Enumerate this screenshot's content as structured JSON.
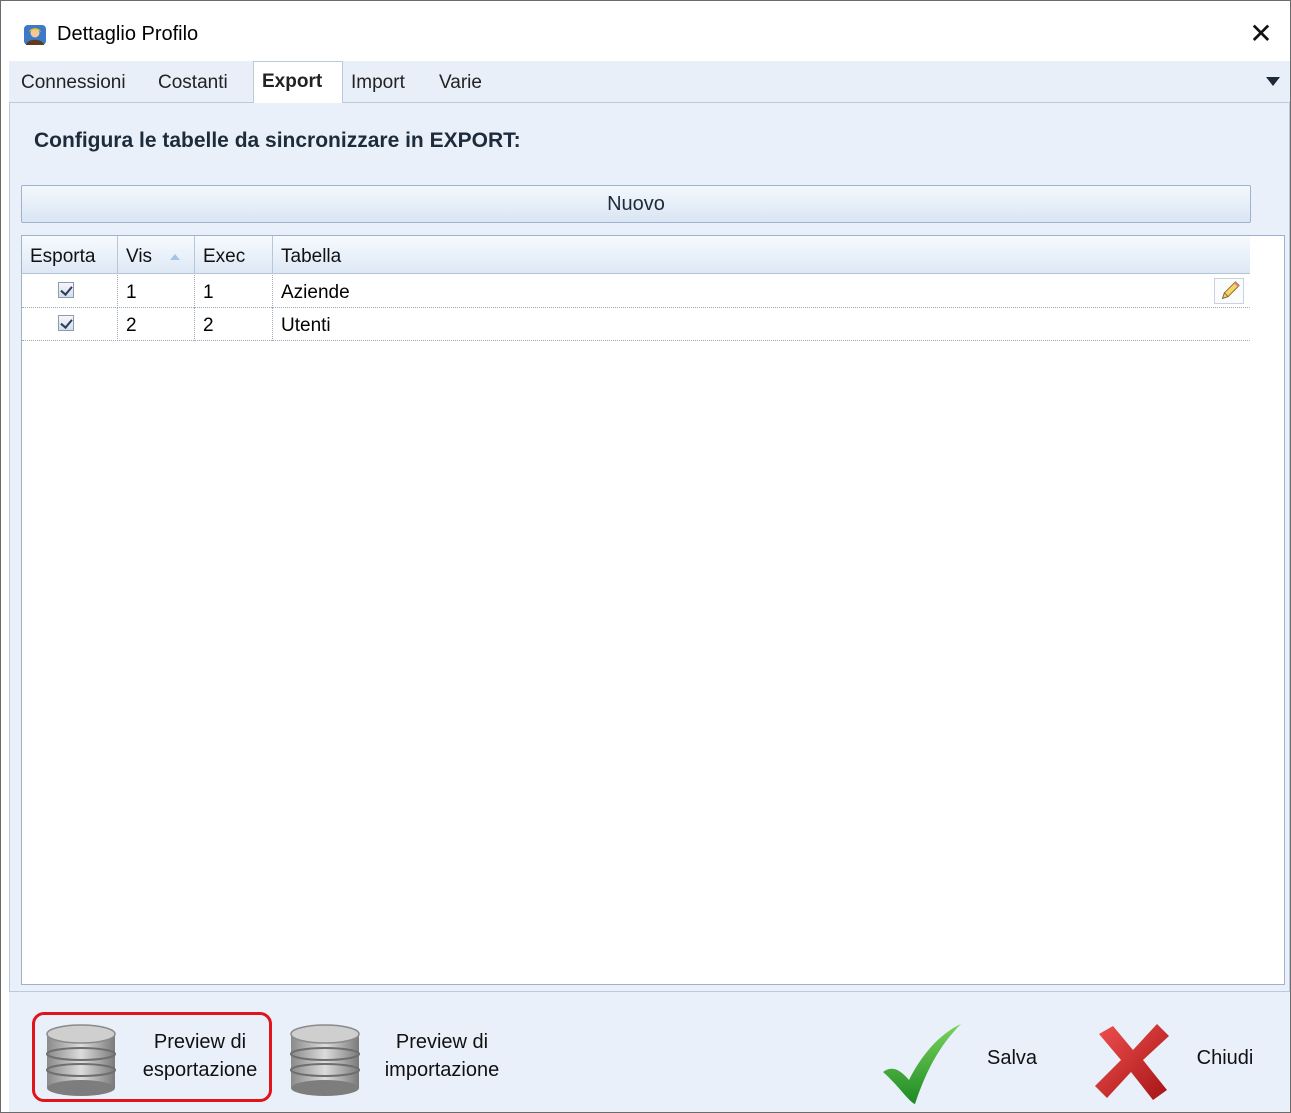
{
  "window": {
    "title": "Dettaglio Profilo",
    "close_glyph": "✕"
  },
  "tabs": [
    {
      "label": "Connessioni",
      "active": false
    },
    {
      "label": "Costanti",
      "active": false
    },
    {
      "label": "Export",
      "active": true
    },
    {
      "label": "Import",
      "active": false
    },
    {
      "label": "Varie",
      "active": false
    }
  ],
  "panel": {
    "heading": "Configura le tabelle da sincronizzare in EXPORT:",
    "new_button": "Nuovo"
  },
  "grid": {
    "columns": [
      "Esporta",
      "Vis",
      "Exec",
      "Tabella"
    ],
    "sorted_column": "Vis",
    "rows": [
      {
        "esporta": true,
        "vis": "1",
        "exec": "1",
        "tabella": "Aziende"
      },
      {
        "esporta": true,
        "vis": "2",
        "exec": "2",
        "tabella": "Utenti"
      }
    ]
  },
  "footer": {
    "preview_export_line1": "Preview di",
    "preview_export_line2": "esportazione",
    "preview_import_line1": "Preview di",
    "preview_import_line2": "importazione",
    "save_label": "Salva",
    "close_label": "Chiudi"
  },
  "colors": {
    "highlight": "#e0141a",
    "save_green": "#2faa2f",
    "close_red": "#d42020",
    "panel_bg": "#e9f0fa"
  },
  "icons": [
    "app-profile-icon",
    "close-icon",
    "chevron-down-icon",
    "pencil-icon",
    "database-icon",
    "checkmark-icon",
    "cross-icon"
  ]
}
